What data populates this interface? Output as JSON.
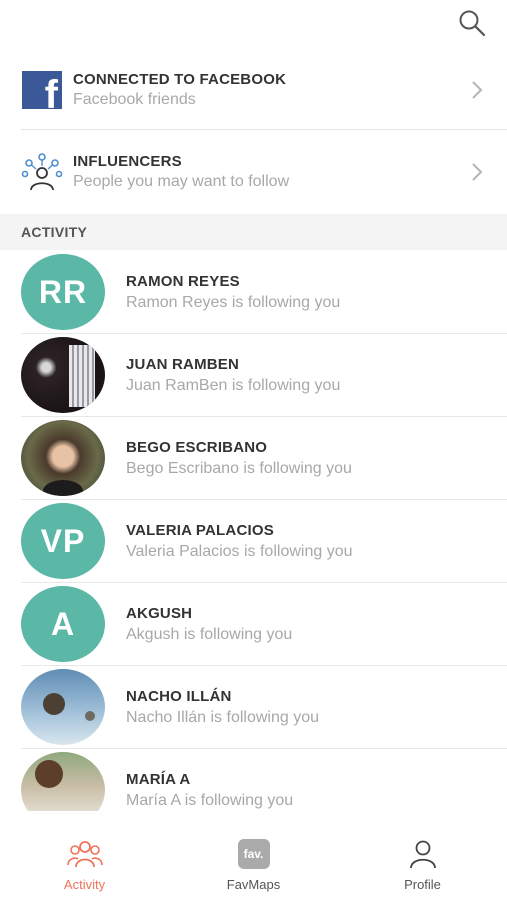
{
  "header": {
    "search_icon": "search-icon"
  },
  "connections": [
    {
      "title": "CONNECTED TO FACEBOOK",
      "subtitle": "Facebook friends",
      "icon": "facebook-icon"
    },
    {
      "title": "INFLUENCERS",
      "subtitle": "People you may want to follow",
      "icon": "influencers-icon"
    }
  ],
  "section": {
    "title": "ACTIVITY"
  },
  "activity": [
    {
      "name": "RAMON REYES",
      "desc": "Ramon Reyes is following you",
      "initials": "RR"
    },
    {
      "name": "JUAN RAMBEN",
      "desc": "Juan RamBen is following you",
      "initials": ""
    },
    {
      "name": "BEGO ESCRIBANO",
      "desc": "Bego Escribano is following you",
      "initials": ""
    },
    {
      "name": "VALERIA PALACIOS",
      "desc": "Valeria Palacios is following you",
      "initials": "VP"
    },
    {
      "name": "AKGUSH",
      "desc": "Akgush is following you",
      "initials": "A"
    },
    {
      "name": "NACHO ILLÁN",
      "desc": "Nacho Illán is following you",
      "initials": ""
    },
    {
      "name": "MARÍA A",
      "desc": "María A is following you",
      "initials": ""
    }
  ],
  "nav": {
    "activity": "Activity",
    "favmaps": "FavMaps",
    "favmaps_badge": "fav.",
    "profile": "Profile",
    "active": "activity"
  },
  "colors": {
    "accent": "#f0735a",
    "avatar": "#5bb7a6",
    "facebook": "#3b5998"
  }
}
